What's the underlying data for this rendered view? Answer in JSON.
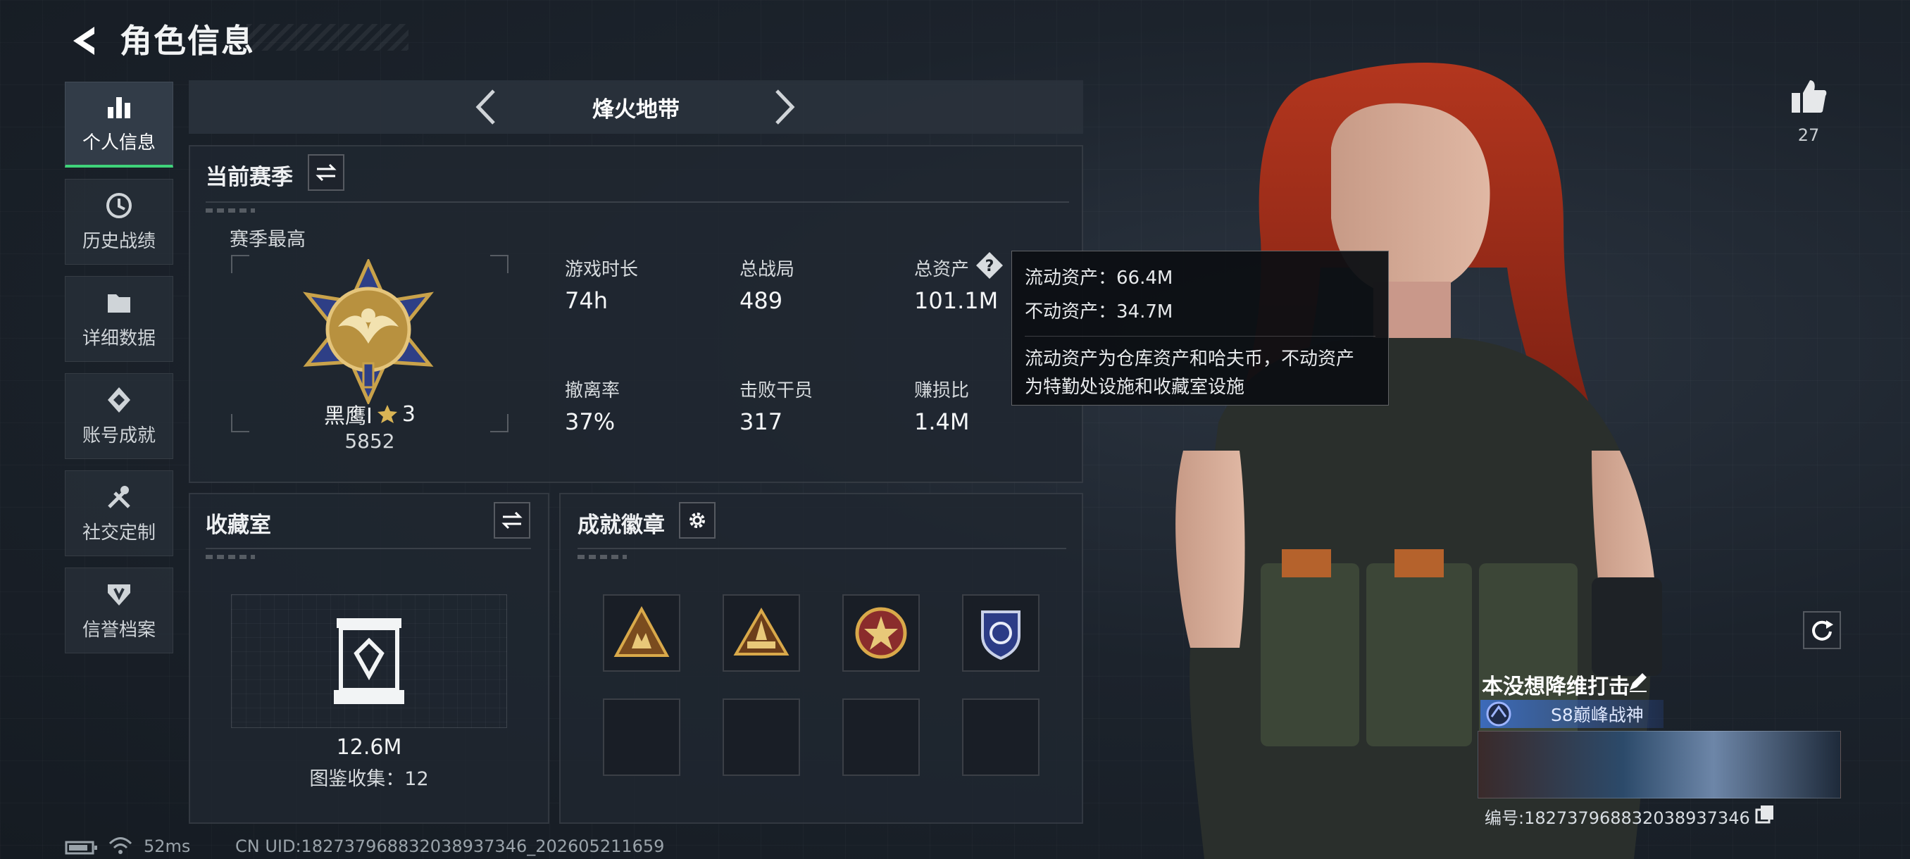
{
  "header": {
    "title": "角色信息"
  },
  "sidebar": {
    "items": [
      {
        "label": "个人信息",
        "icon": "bar-chart-icon",
        "active": true
      },
      {
        "label": "历史战绩",
        "icon": "history-icon",
        "active": false
      },
      {
        "label": "详细数据",
        "icon": "folder-icon",
        "active": false
      },
      {
        "label": "账号成就",
        "icon": "achievement-icon",
        "active": false
      },
      {
        "label": "社交定制",
        "icon": "tools-icon",
        "active": false
      },
      {
        "label": "信誉档案",
        "icon": "shield-icon",
        "active": false
      }
    ]
  },
  "mode": {
    "label": "烽火地带"
  },
  "season": {
    "title": "当前赛季",
    "best_label": "赛季最高",
    "rank_name": "黑鹰Ⅰ",
    "rank_stars": "3",
    "rank_score": "5852",
    "stats": [
      {
        "label": "游戏时长",
        "value": "74h"
      },
      {
        "label": "总战局",
        "value": "489"
      },
      {
        "label": "总资产",
        "value": "101.1M"
      },
      {
        "label": "撤离率",
        "value": "37%"
      },
      {
        "label": "击败干员",
        "value": "317"
      },
      {
        "label": "赚损比",
        "value": "1.4M"
      }
    ]
  },
  "tooltip": {
    "liquid": "流动资产：66.4M",
    "fixed": "不动资产：34.7M",
    "desc_line1": "流动资产为仓库资产和哈夫币，不动资产",
    "desc_line2": "为特勤处设施和收藏室设施"
  },
  "collection": {
    "title": "收藏室",
    "value": "12.6M",
    "count_text": "图鉴收集：12"
  },
  "achievements": {
    "title": "成就徽章",
    "badges": [
      "badge-1-icon",
      "badge-2-icon",
      "badge-3-icon",
      "badge-4-icon"
    ]
  },
  "likes": {
    "count": "27"
  },
  "player": {
    "name": "本没想降维打击",
    "title": "S8巅峰战神",
    "uid_line": "编号:18273796883203893734​6"
  },
  "status_bar": {
    "ping": "52ms",
    "uid": "CN UID:18273796883203893734​6_202605211659"
  },
  "colors": {
    "accent": "#3fd37a",
    "gold": "#c9a24a",
    "title_blue": "#3c6ec8"
  }
}
